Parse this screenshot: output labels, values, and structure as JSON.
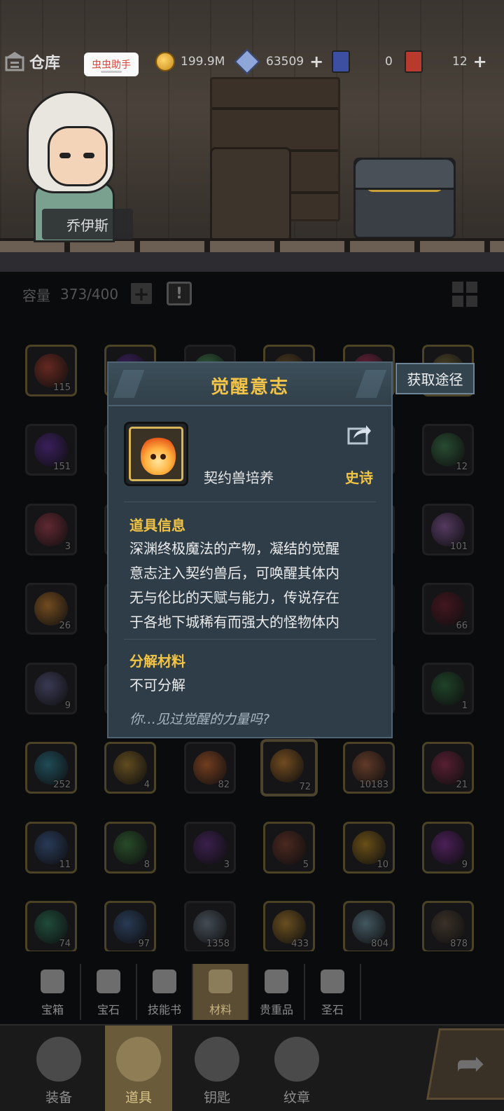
{
  "header": {
    "title": "仓库",
    "tag": "虫虫助手",
    "gold": "199.9M",
    "crystals": "63509",
    "ticket_blue": "0",
    "ticket_red": "12"
  },
  "hero": {
    "name": "乔伊斯"
  },
  "capacity": {
    "label": "容量",
    "value": "373/400"
  },
  "inventory": {
    "counts": [
      "115",
      "",
      "",
      "",
      "",
      "",
      "151",
      "",
      "",
      "",
      "",
      "12",
      "3",
      "",
      "",
      "",
      "",
      "101",
      "26",
      "",
      "",
      "",
      "",
      "66",
      "9",
      "",
      "",
      "",
      "",
      "1",
      "252",
      "4",
      "82",
      "72",
      "10183",
      "21",
      "11",
      "8",
      "3",
      "5",
      "10",
      "9",
      "74",
      "97",
      "1358",
      "433",
      "804",
      "878"
    ]
  },
  "dialog": {
    "title": "觉醒意志",
    "source_button": "获取途径",
    "category": "契约兽培养",
    "rarity": "史诗",
    "info_title": "道具信息",
    "info_lines": [
      "深渊终极魔法的产物，凝结的觉醒",
      "意志注入契约兽后，可唤醒其体内",
      "无与伦比的天赋与能力，传说存在",
      "于各地下城稀有而强大的怪物体内"
    ],
    "decompose_title": "分解材料",
    "decompose_value": "不可分解",
    "flavor": "你…见过觉醒的力量吗?"
  },
  "categories": [
    "宝箱",
    "宝石",
    "技能书",
    "材料",
    "贵重品",
    "圣石"
  ],
  "bottom_nav": [
    "装备",
    "道具",
    "钥匙",
    "纹章"
  ],
  "colors": {
    "accent_gold": "#f1c445",
    "dialog_bg": "#2e3d47"
  }
}
